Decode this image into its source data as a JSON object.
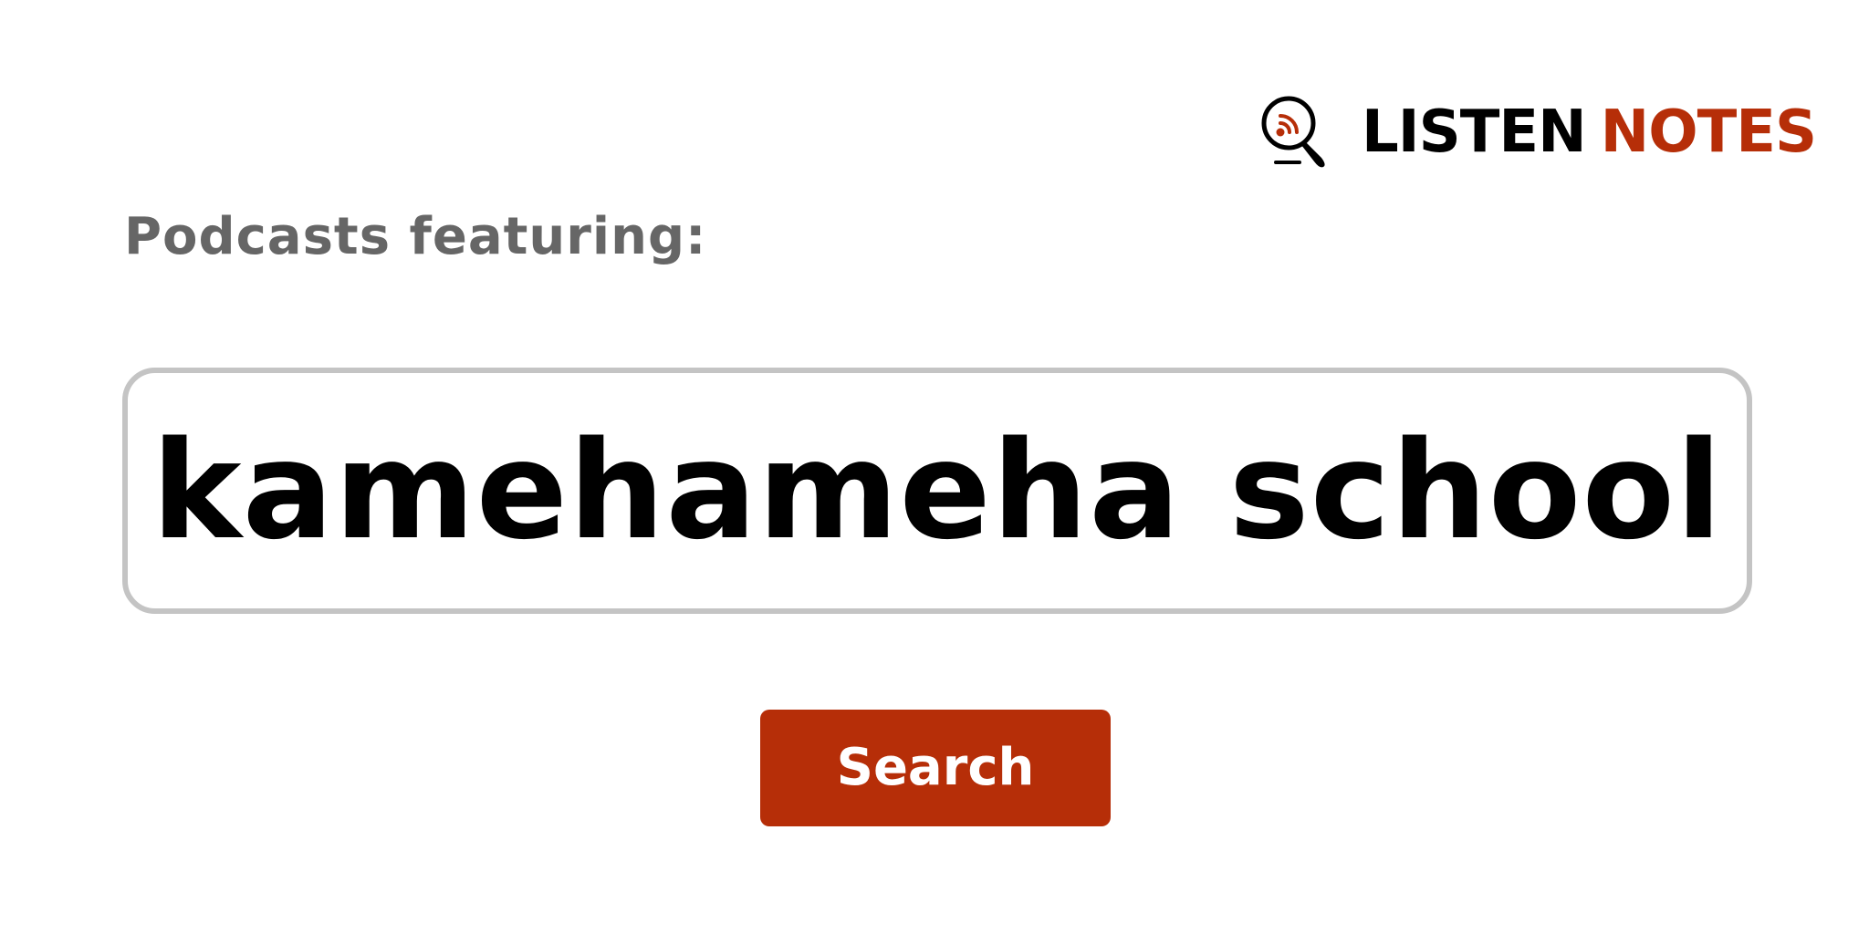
{
  "logo": {
    "word1": "LISTEN",
    "word2": "NOTES",
    "icon": "podcast-search-icon",
    "colors": {
      "dark": "#000000",
      "accent": "#b62e08"
    }
  },
  "heading": "Podcasts featuring:",
  "search": {
    "value": "kamehameha school",
    "border_color": "#c4c4c4"
  },
  "button": {
    "label": "Search",
    "color": "#b62e08"
  }
}
